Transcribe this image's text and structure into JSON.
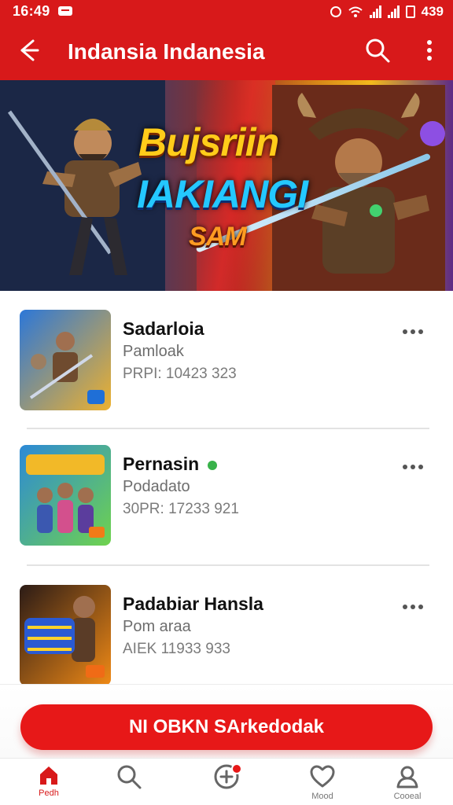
{
  "status": {
    "time": "16:49",
    "battery": "439"
  },
  "appbar": {
    "title": "Indansia Indanesia"
  },
  "banner": {
    "line1": "Bujsriin",
    "line2": "IAKIANGI",
    "line3": "SAM"
  },
  "list": {
    "items": [
      {
        "name": "Sadarloia",
        "subtitle": "Pamloak",
        "meta": "PRPI: 10423 323"
      },
      {
        "name": "Pernasin",
        "subtitle": "Podadato",
        "meta": "30PR: 17233 921"
      },
      {
        "name": "Padabiar Hansla",
        "subtitle": "Pom araa",
        "meta": "AIEK 11933 933"
      }
    ]
  },
  "cta": {
    "label": "NI OBKN SArkedodak"
  },
  "nav": {
    "tabs": [
      {
        "label": "Pedh"
      },
      {
        "label": ""
      },
      {
        "label": ""
      },
      {
        "label": "Mood"
      },
      {
        "label": "Cooeal"
      }
    ]
  },
  "colors": {
    "brand": "#d8191a",
    "cta": "#e71818"
  },
  "icons": {
    "back": "arrow-left-icon",
    "search": "search-icon",
    "more": "more-vertical-icon",
    "home": "home-icon",
    "heart": "heart-icon",
    "profile": "user-icon"
  }
}
